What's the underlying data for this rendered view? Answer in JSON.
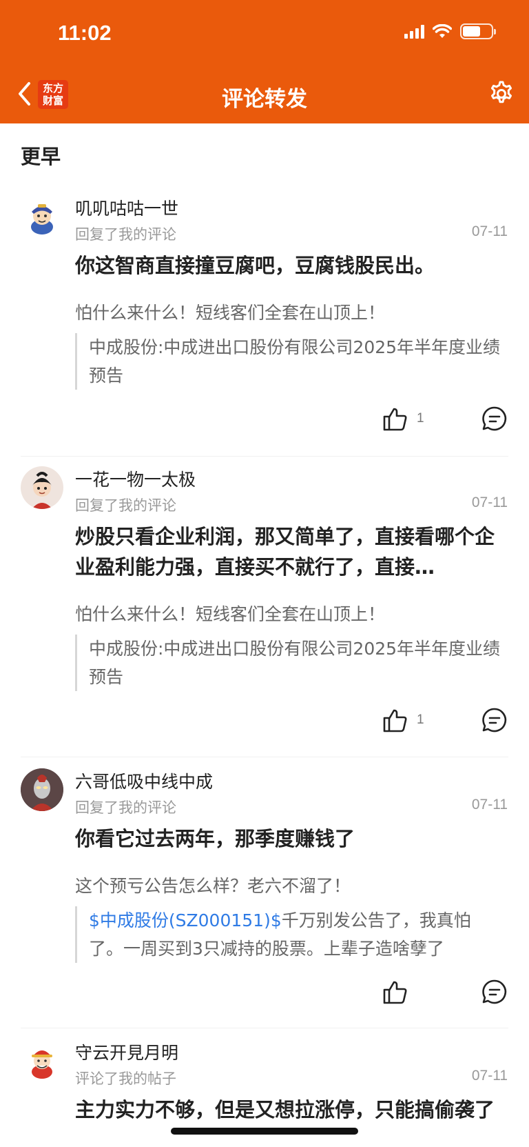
{
  "status_bar": {
    "time": "11:02"
  },
  "nav": {
    "logo_text": "东方财富",
    "logo_line1": "东方",
    "logo_line2": "财富",
    "title": "评论转发"
  },
  "section": {
    "title": "更早"
  },
  "items": [
    {
      "username": "叽叽咕咕一世",
      "action": "回复了我的评论",
      "date": "07-11",
      "reply": "你这智商直接撞豆腐吧，豆腐钱股民出。",
      "my_comment": "怕什么来什么！短线客们全套在山顶上！",
      "quote_text": "中成股份:中成进出口股份有限公司2025年半年度业绩预告",
      "like_count": "1"
    },
    {
      "username": "一花一物一太极",
      "action": "回复了我的评论",
      "date": "07-11",
      "reply": "炒股只看企业利润，那又简单了，直接看哪个企业盈利能力强，直接买不就行了，直接…",
      "my_comment": "怕什么来什么！短线客们全套在山顶上！",
      "quote_text": "中成股份:中成进出口股份有限公司2025年半年度业绩预告",
      "like_count": "1"
    },
    {
      "username": "六哥低吸中线中成",
      "action": "回复了我的评论",
      "date": "07-11",
      "reply": "你看它过去两年，那季度赚钱了",
      "my_comment": "这个预亏公告怎么样？老六不溜了！",
      "quote_link": "$中成股份(SZ000151)$",
      "quote_text": "千万别发公告了，我真怕了。一周买到3只减持的股票。上辈子造啥孽了",
      "like_count": ""
    },
    {
      "username": "守云开見月明",
      "action": "评论了我的帖子",
      "date": "07-11",
      "reply": "主力实力不够，但是又想拉涨停，只能搞偷袭了"
    }
  ],
  "colors": {
    "brand": "#ea5a0c",
    "link": "#2f7be5"
  }
}
